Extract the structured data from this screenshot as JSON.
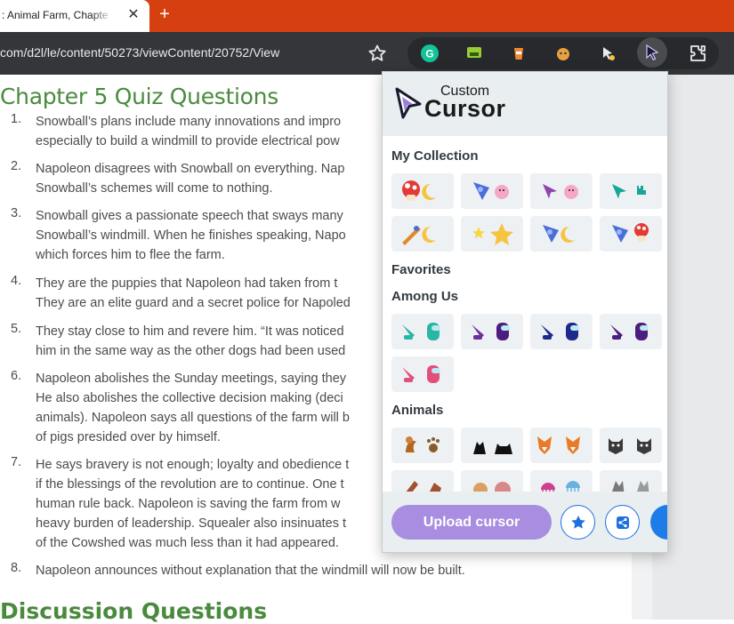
{
  "tab": {
    "title": ": Animal Farm, Chapte"
  },
  "toolbar": {
    "url": "com/d2l/le/content/50273/viewContent/20752/View"
  },
  "page": {
    "chapter_title": "Chapter 5 Quiz Questions",
    "questions": [
      {
        "num": "1.",
        "lines": [
          "Snowball’s plans include many innovations and impro",
          "especially to build a windmill to provide electrical pow"
        ]
      },
      {
        "num": "2.",
        "lines": [
          "Napoleon disagrees with Snowball on everything. Nap",
          "Snowball’s schemes will come to nothing."
        ]
      },
      {
        "num": "3.",
        "lines": [
          "Snowball gives a passionate speech that sways many",
          "Snowball’s windmill. When he finishes speaking, Napo",
          "which forces him to flee the farm."
        ]
      },
      {
        "num": "4.",
        "lines": [
          "They are the puppies that Napoleon had taken from t",
          "They are an elite guard and a secret police for Napoled"
        ]
      },
      {
        "num": "5.",
        "lines": [
          "They stay close to him and revere him. “It was noticed",
          "him in the same way as the other dogs had been used"
        ]
      },
      {
        "num": "6.",
        "lines": [
          "Napoleon abolishes the Sunday meetings, saying they",
          "He also abolishes the collective decision making (deci",
          "animals). Napoleon says all questions of the farm will b",
          "of pigs presided over by himself."
        ]
      },
      {
        "num": "7.",
        "lines": [
          "He says bravery is not enough; loyalty and obedience t",
          "if the blessings of the revolution are to continue. One t",
          "human rule back. Napoleon is saving the farm from w",
          "heavy burden of leadership. Squealer also insinuates t",
          "of the Cowshed was much less than it had appeared."
        ]
      },
      {
        "num": "8.",
        "lines": [
          "Napoleon announces without explanation that the windmill will now be built."
        ]
      }
    ],
    "discussion_title": "Discussion Questions"
  },
  "popup": {
    "logo_small": "Custom",
    "logo_big": "Cursor",
    "sections": {
      "collection": "My Collection",
      "favorites": "Favorites",
      "among_us": "Among Us",
      "animals": "Animals"
    },
    "collection_items": [
      "mushroom-moon-cursor",
      "bluefish-kirby-cursor",
      "purple-arrow-kirby-cursor",
      "teal-arrow-hand-cursor",
      "rocket-moon-cursor",
      "star-yellow-cursor",
      "bluefish-moon-cursor",
      "bluefish-toad-cursor"
    ],
    "among_us_items": [
      "teal-crewmate-cursor",
      "purple-crewmate-cursor",
      "navy-crewmate-cursor",
      "purple-crewmate-2-cursor",
      "pink-crewmate-cursor"
    ],
    "animal_items": [
      "squirrel-paw-cursor",
      "black-cat-cursor",
      "fox-cursor",
      "gray-cat-cursor",
      "brown-dog-cursor",
      "tiger-cursor",
      "jellyfish-cursor",
      "wolf-cursor"
    ],
    "upload_label": "Upload cursor"
  },
  "colors": {
    "brand": "#d64010",
    "heading": "#4a8a3e",
    "accent": "#a88de0",
    "button_blue": "#1e6fe0"
  }
}
